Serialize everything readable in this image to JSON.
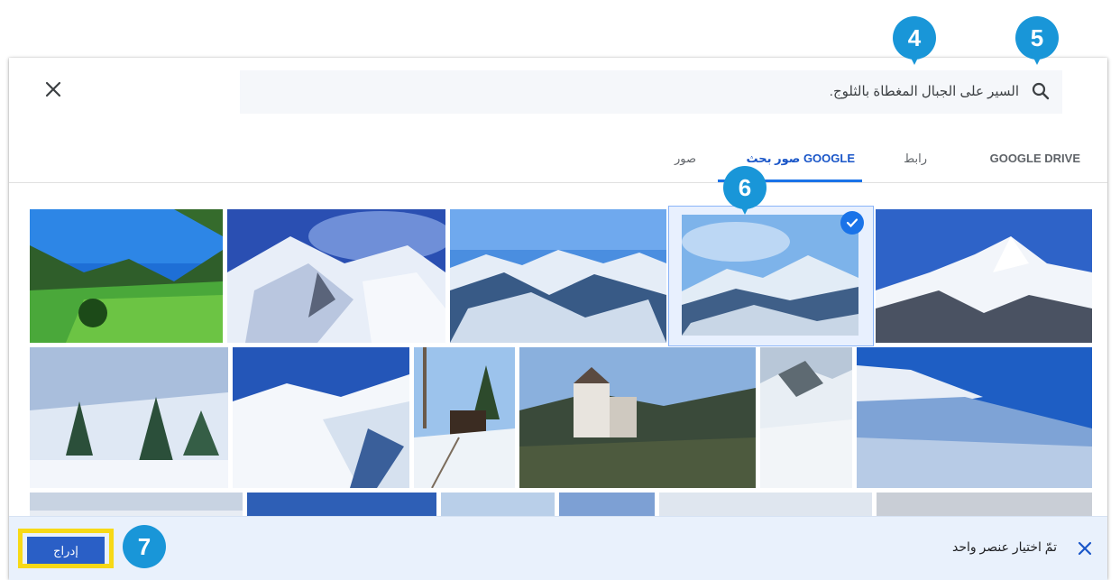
{
  "dialog": {
    "close_icon": "close-icon",
    "search": {
      "query": "السير على الجبال المغطاة بالثلوج.",
      "icon": "search-icon"
    },
    "tabs": [
      {
        "label": "GOOGLE DRIVE",
        "active": false
      },
      {
        "label": "رابط",
        "active": false
      },
      {
        "label": "صور بحث GOOGLE",
        "active": true
      },
      {
        "label": "صور",
        "active": false
      }
    ],
    "results": {
      "selected_index": 3,
      "check_icon": "check-icon"
    },
    "footer": {
      "status": "تمّ اختيار عنصر واحد",
      "insert_label": "إدراج",
      "deselect_icon": "close-icon"
    }
  },
  "markers": {
    "m4": "4",
    "m5": "5",
    "m6": "6",
    "m7": "7"
  },
  "colors": {
    "accent": "#1a73e8",
    "marker": "#1996d8",
    "highlight": "#f7d916",
    "insert_button": "#2a5fc6"
  }
}
